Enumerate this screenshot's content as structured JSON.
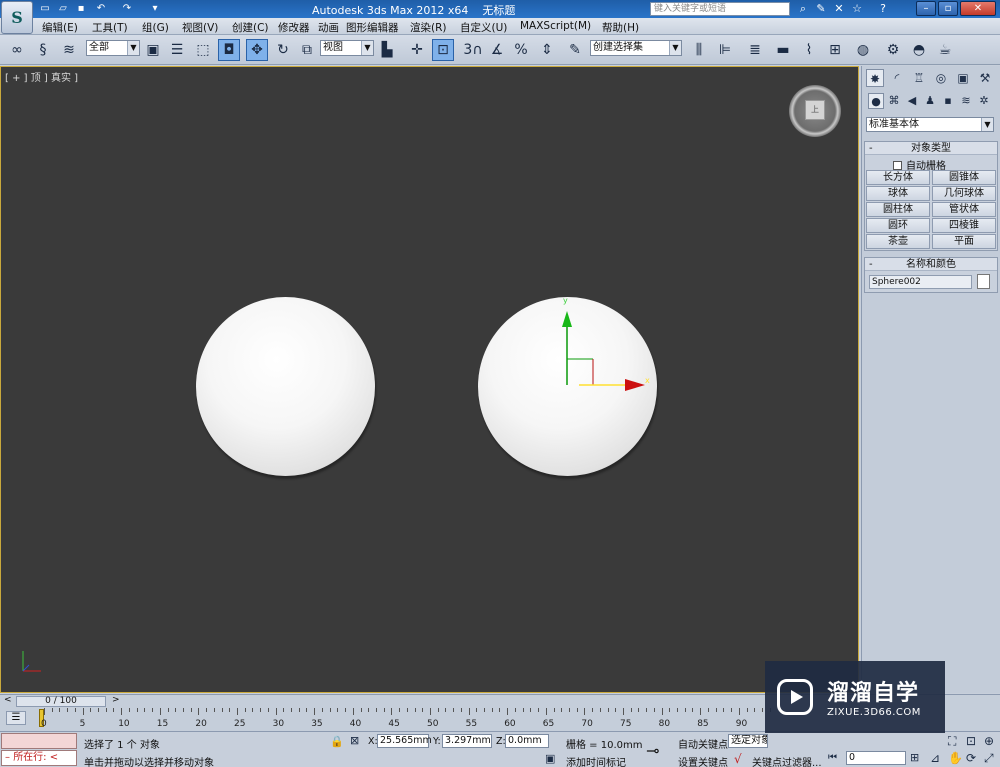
{
  "app": {
    "title": "Autodesk 3ds Max  2012 x64",
    "document": "无标题",
    "search_placeholder": "键入关键字或短语"
  },
  "menu": [
    "编辑(E)",
    "工具(T)",
    "组(G)",
    "视图(V)",
    "创建(C)",
    "修改器",
    "动画",
    "图形编辑器",
    "渲染(R)",
    "自定义(U)",
    "MAXScript(M)",
    "帮助(H)"
  ],
  "toolbar": {
    "selection_filter": "全部",
    "ref_coord": "视图",
    "named_selection": "创建选择集",
    "snap_labels": [
      "3",
      "%"
    ]
  },
  "viewport": {
    "label": "[ + ] 顶 ] 真实 ]",
    "viewcube_face": "上",
    "gizmo_x": "x",
    "gizmo_y": "y"
  },
  "command_panel": {
    "category": "标准基本体",
    "object_type": {
      "title": "对象类型",
      "autogrid": "自动栅格",
      "buttons": [
        "长方体",
        "圆锥体",
        "球体",
        "几何球体",
        "圆柱体",
        "管状体",
        "圆环",
        "四棱锥",
        "茶壶",
        "平面"
      ]
    },
    "name_color": {
      "title": "名称和颜色",
      "name": "Sphere002",
      "color": "#ffffff"
    }
  },
  "timeline": {
    "frame_counter": "0 / 100",
    "ticks": [
      "0",
      "5",
      "10",
      "15",
      "20",
      "25",
      "30",
      "35",
      "40",
      "45",
      "50",
      "55",
      "60",
      "65",
      "70",
      "75",
      "80",
      "85",
      "90"
    ]
  },
  "status": {
    "maxscript_prompt": "所在行:",
    "selected": "选择了 1 个 对象",
    "prompt": "单击并拖动以选择并移动对象",
    "x_label": "X:",
    "x": "25.565mm",
    "y_label": "Y:",
    "y": "3.297mm",
    "z_label": "Z:",
    "z": "0.0mm",
    "grid": "栅格 = 10.0mm",
    "add_marker": "添加时间标记",
    "auto_key": "自动关键点",
    "set_key": "设置关键点",
    "selection_mode": "选定对象",
    "key_filters": "关键点过滤器...",
    "frame": "0"
  },
  "watermark": {
    "title": "溜溜自学",
    "url": "ZIXUE.3D66.COM"
  }
}
